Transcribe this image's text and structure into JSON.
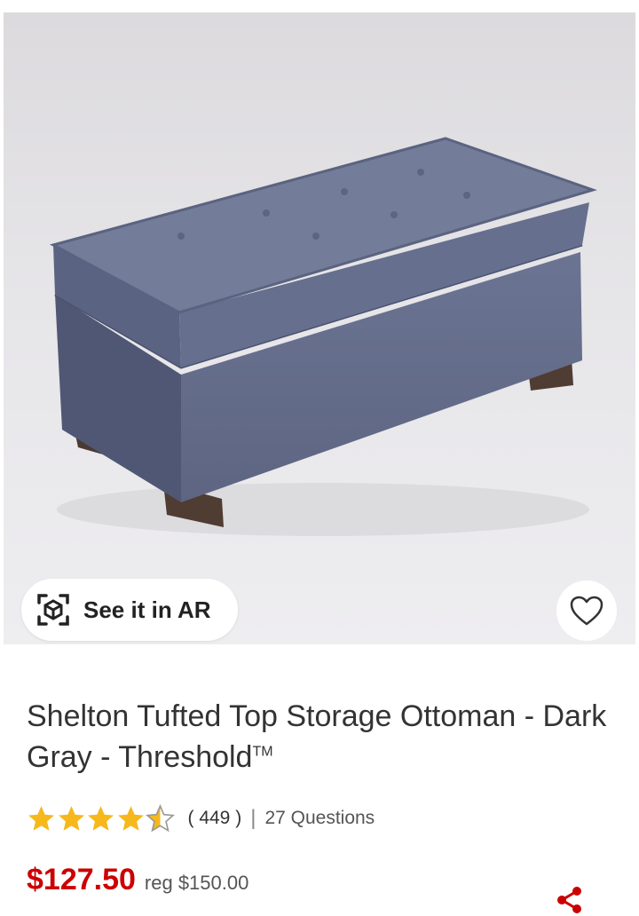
{
  "product": {
    "image_alt": "Shelton Tufted Top Storage Ottoman",
    "ar_button_label": "See it in AR",
    "title": "Shelton Tufted Top Storage Ottoman - Dark Gray - Threshold",
    "trademark": "TM",
    "rating": {
      "stars": 4.5,
      "review_count": "( 449 )",
      "divider": "|",
      "questions_label": "27 Questions"
    },
    "price": {
      "current": "$127.50",
      "regular": "reg $150.00"
    }
  },
  "icons": {
    "ar": "ar-cube-icon",
    "favorite": "heart-outline-icon",
    "share": "share-icon",
    "star_full": "star-icon",
    "star_half": "star-half-icon"
  },
  "colors": {
    "price_red": "#cc0000",
    "star_gold": "#f6b81a",
    "text": "#333333"
  }
}
